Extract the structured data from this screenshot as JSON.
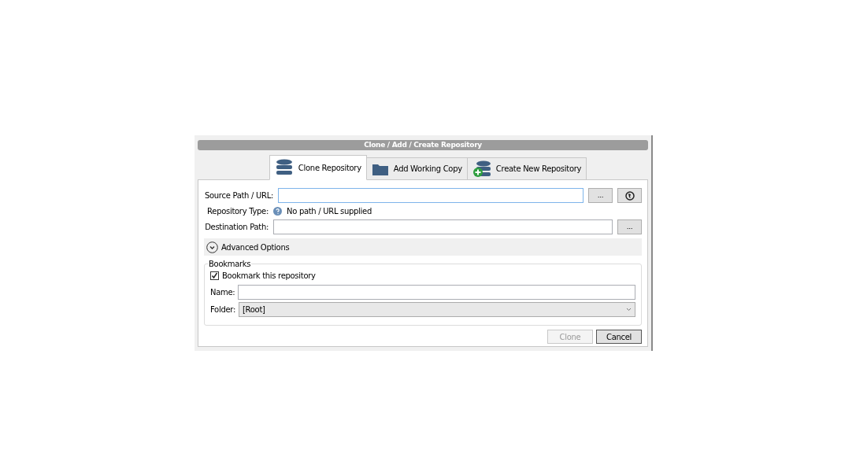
{
  "window": {
    "title": "Clone  / Add / Create Repository"
  },
  "tabs": [
    {
      "label": "Clone Repository",
      "kind": "clone",
      "selected": true
    },
    {
      "label": "Add Working Copy",
      "kind": "folder",
      "selected": false
    },
    {
      "label": "Create New Repository",
      "kind": "create",
      "selected": false
    }
  ],
  "form": {
    "source_label": "Source Path / URL:",
    "source_browse": "...",
    "type_label": "Repository Type:",
    "type_value": "No path / URL supplied",
    "destination_label": "Destination Path:",
    "destination_browse": "..."
  },
  "advanced": {
    "label": "Advanced Options",
    "expanded": false
  },
  "bookmarks": {
    "legend": "Bookmarks",
    "checkbox_label": "Bookmark this repository",
    "checked": true,
    "name_label": "Name:",
    "folder_label": "Folder:",
    "folder_value": "[Root]"
  },
  "buttons": [
    {
      "label": "Clone",
      "disabled": true
    },
    {
      "label": "Cancel",
      "disabled": false
    }
  ]
}
